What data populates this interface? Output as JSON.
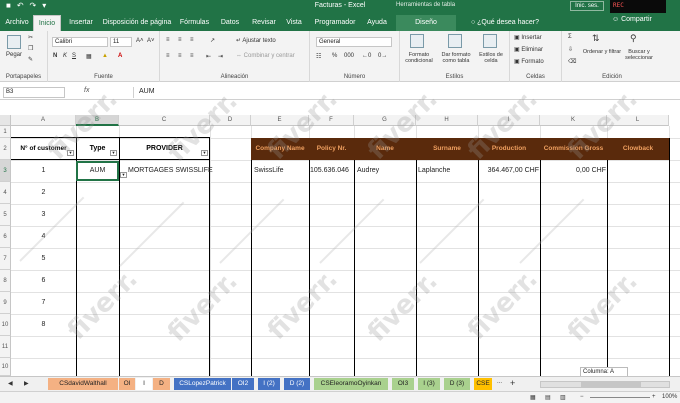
{
  "window": {
    "title": "Facturas  -  Excel",
    "tool_title": "Herramientas de tabla",
    "sign_in": "Inic. ses.",
    "share": "Compartir",
    "tell_me": "¿Qué desea hacer?"
  },
  "tabs": [
    "Archivo",
    "Inicio",
    "Insertar",
    "Disposición de página",
    "Fórmulas",
    "Datos",
    "Revisar",
    "Vista",
    "Programador",
    "Ayuda",
    "Diseño"
  ],
  "ribbon": {
    "clipboard": {
      "label": "Portapapeles",
      "paste": "Pegar"
    },
    "font": {
      "label": "Fuente",
      "name": "Calibri",
      "size": "11",
      "bold": "N",
      "italic": "K",
      "underline": "S"
    },
    "alignment": {
      "label": "Alineación",
      "wrap": "Ajustar texto",
      "merge": "Combinar y centrar"
    },
    "number": {
      "label": "Número",
      "format": "General",
      "percent": "%",
      "thousands": "000"
    },
    "styles": {
      "label": "Estilos",
      "conditional": "Formato condicional",
      "as_table": "Dar formato como tabla",
      "cell_styles": "Estilos de celda"
    },
    "cells": {
      "label": "Celdas",
      "insert": "Insertar",
      "delete": "Eliminar",
      "format": "Formato"
    },
    "editing": {
      "label": "Edición",
      "sort": "Ordenar y filtrar",
      "find": "Buscar y seleccionar"
    }
  },
  "formula_bar": {
    "name_box": "B3",
    "fx": "fx",
    "value": "AUM"
  },
  "columns": [
    "A",
    "B",
    "C",
    "D",
    "E",
    "F",
    "G",
    "H",
    "I",
    "K",
    "L"
  ],
  "rows": [
    "1",
    "2",
    "3",
    "4",
    "5",
    "6",
    "7",
    "8",
    "9",
    "10",
    "11",
    "10"
  ],
  "left_table": {
    "headers": [
      "N° of customer",
      "Type",
      "PROVIDER"
    ],
    "row": {
      "num": "1",
      "type": "AUM",
      "provider": "MORTGAGES SWISSLIFE"
    },
    "numbers": [
      "2",
      "3",
      "4",
      "5",
      "6",
      "7",
      "8"
    ]
  },
  "right_table": {
    "headers": [
      "Company Name",
      "Policy Nr.",
      "Name",
      "Surname",
      "Production",
      "Commission Gross",
      "Clowback"
    ],
    "row": [
      "SwissLife",
      "105.636.046",
      "Audrey",
      "Laplanche",
      "364.467,00 CHF",
      "0,00 CHF",
      ""
    ]
  },
  "sheet_tabs": [
    {
      "label": "CSdavidWalthall",
      "color": "#f4b183"
    },
    {
      "label": "OI",
      "color": "#f4b183"
    },
    {
      "label": "I",
      "color": "#ffffff"
    },
    {
      "label": "D",
      "color": "#f4b183"
    },
    {
      "label": "CSLopezPatrick",
      "color": "#4472c4"
    },
    {
      "label": "OI2",
      "color": "#4472c4"
    },
    {
      "label": "I (2)",
      "color": "#4472c4"
    },
    {
      "label": "D (2)",
      "color": "#4472c4"
    },
    {
      "label": "CSEleoramoOyinkan",
      "color": "#a9d18e"
    },
    {
      "label": "OI3",
      "color": "#a9d18e"
    },
    {
      "label": "I (3)",
      "color": "#a9d18e"
    },
    {
      "label": "D (3)",
      "color": "#a9d18e"
    },
    {
      "label": "CSE",
      "color": "#ffc000"
    }
  ],
  "sheet_nav": {
    "add": "+",
    "more": "..."
  },
  "tooltip": "Columna: A",
  "status": {
    "zoom": "100%"
  },
  "watermark": "fiverr.",
  "webcam": "REC"
}
